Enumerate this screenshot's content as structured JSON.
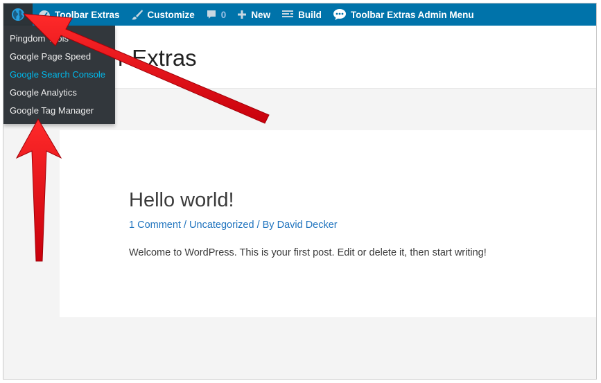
{
  "admin_bar": {
    "toolbar_extras": "Toolbar Extras",
    "customize": "Customize",
    "comments_count": "0",
    "new": "New",
    "build": "Build",
    "admin_menu": "Toolbar Extras Admin Menu",
    "icons": [
      "globe-icon",
      "dashboard-icon",
      "brush-icon",
      "comment-icon",
      "plus-icon",
      "build-icon",
      "chat-icon"
    ]
  },
  "dropdown": {
    "items": [
      "Pingdom Tools",
      "Google Page Speed",
      "Google Search Console",
      "Google Analytics",
      "Google Tag Manager"
    ],
    "active_index": 2
  },
  "site": {
    "title_visible": "r Extras"
  },
  "post": {
    "title": "Hello world!",
    "comments": "1 Comment",
    "separator": " / ",
    "category": "Uncategorized",
    "by": " / By ",
    "author": "David Decker",
    "excerpt": "Welcome to WordPress. This is your first post. Edit or delete it, then start writing!"
  },
  "colors": {
    "admin_bar": "#0073aa",
    "dropdown_bg": "#32373c",
    "active_link": "#00b9eb",
    "link": "#1e73be",
    "annotation_arrow": "#e8141e"
  }
}
